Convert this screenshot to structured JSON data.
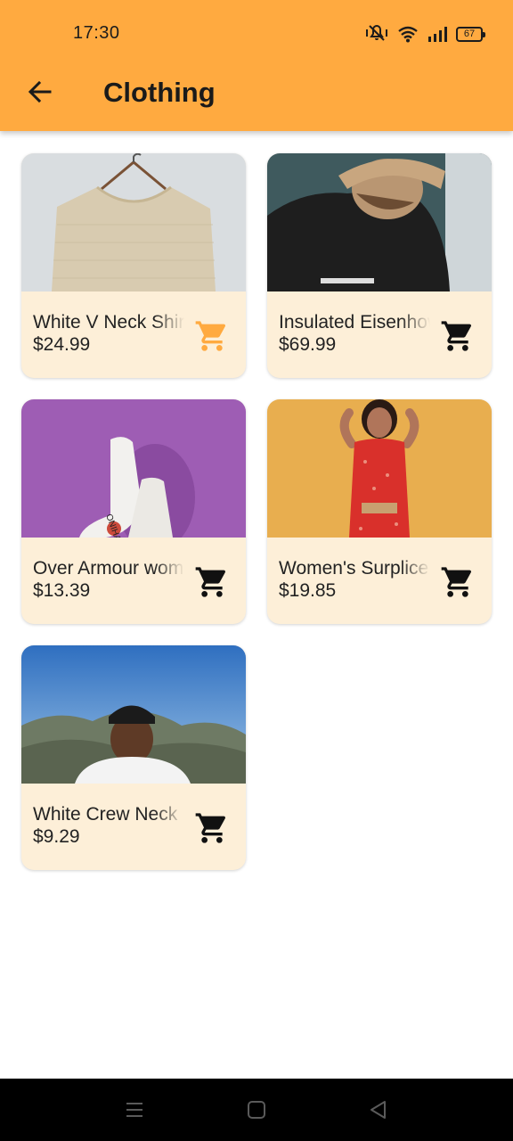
{
  "status_bar": {
    "time": "17:30",
    "battery": "67",
    "icons": [
      "mute-vibrate-icon",
      "wifi-icon",
      "signal-icon",
      "battery-icon"
    ]
  },
  "app_bar": {
    "title": "Clothing",
    "back_icon": "arrow-back-icon",
    "background": "#FFAA40"
  },
  "products": [
    {
      "name": "White V Neck Shirt",
      "price": "$24.99",
      "icon": "cart-icon",
      "icon_color": "#FFAA40"
    },
    {
      "name": "Insulated Eisenhower",
      "price": "$69.99",
      "icon": "cart-icon",
      "icon_color": "#111111"
    },
    {
      "name": "Over Armour women",
      "price": "$13.39",
      "icon": "cart-icon",
      "icon_color": "#111111"
    },
    {
      "name": " Women's Surplice",
      "price": "$19.85",
      "icon": "cart-icon",
      "icon_color": "#111111"
    },
    {
      "name": "White Crew Neck",
      "price": "$9.29",
      "icon": "cart-icon",
      "icon_color": "#111111"
    }
  ],
  "colors": {
    "card_background": "#FDEFD8",
    "accent": "#FFAA40"
  },
  "nav_bar": {
    "icons": [
      "menu-icon",
      "home-icon",
      "back-icon"
    ]
  }
}
